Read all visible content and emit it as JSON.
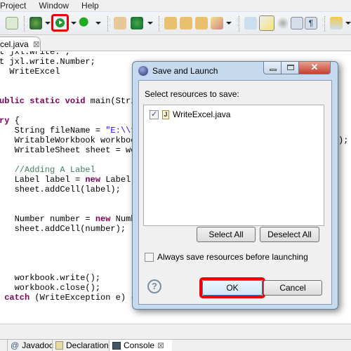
{
  "menu": [
    "Project",
    "Window",
    "Help"
  ],
  "editor_tab": {
    "label": "cel.java",
    "close": "⊠"
  },
  "code_lines": [
    [
      {
        "t": "t jxl.write.*;"
      }
    ],
    [
      {
        "t": "t jxl.write.Number;"
      }
    ],
    [
      {
        "t": "  WriteExcel"
      }
    ],
    [],
    [],
    [
      {
        "t": "ublic static void ",
        "c": "kw"
      },
      {
        "t": "main(String"
      }
    ],
    [],
    [
      {
        "t": "ry ",
        "c": "kw"
      },
      {
        "t": "{"
      }
    ],
    [
      {
        "t": "   String fileName = "
      },
      {
        "t": "\"E:\\\\fil",
        "c": "str"
      }
    ],
    [
      {
        "t": "   WritableWorkbook workbook"
      }
    ],
    [
      {
        "t": "   WritableSheet sheet = work"
      }
    ],
    [],
    [
      {
        "t": "   //Adding A Label",
        "c": "cm"
      }
    ],
    [
      {
        "t": "   Label label = "
      },
      {
        "t": "new",
        "c": "kw"
      },
      {
        "t": " Label(0,"
      }
    ],
    [
      {
        "t": "   sheet.addCell(label);"
      }
    ],
    [],
    [],
    [
      {
        "t": "   Number number = "
      },
      {
        "t": "new",
        "c": "kw"
      },
      {
        "t": " Number"
      }
    ],
    [
      {
        "t": "   sheet.addCell(number);"
      }
    ],
    [],
    [],
    [],
    [],
    [
      {
        "t": "   workbook.write();"
      }
    ],
    [
      {
        "t": "   workbook.close();"
      }
    ],
    [
      {
        "t": " "
      },
      {
        "t": "catch",
        "c": "kw"
      },
      {
        "t": " (WriteException e) {"
      }
    ]
  ],
  "code_right_fragment": ");",
  "bottom_tabs": [
    "Javadoc",
    "Declaration",
    "Console"
  ],
  "dialog": {
    "title": "Save and Launch",
    "label": "Select resources to save:",
    "resources": [
      {
        "name": "WriteExcel.java",
        "checked": true
      }
    ],
    "select_all": "Select All",
    "deselect_all": "Deselect All",
    "always_save": {
      "label": "Always save resources before launching",
      "checked": false
    },
    "help": "?",
    "ok": "OK",
    "cancel": "Cancel"
  },
  "highlight_color": "#e00000"
}
